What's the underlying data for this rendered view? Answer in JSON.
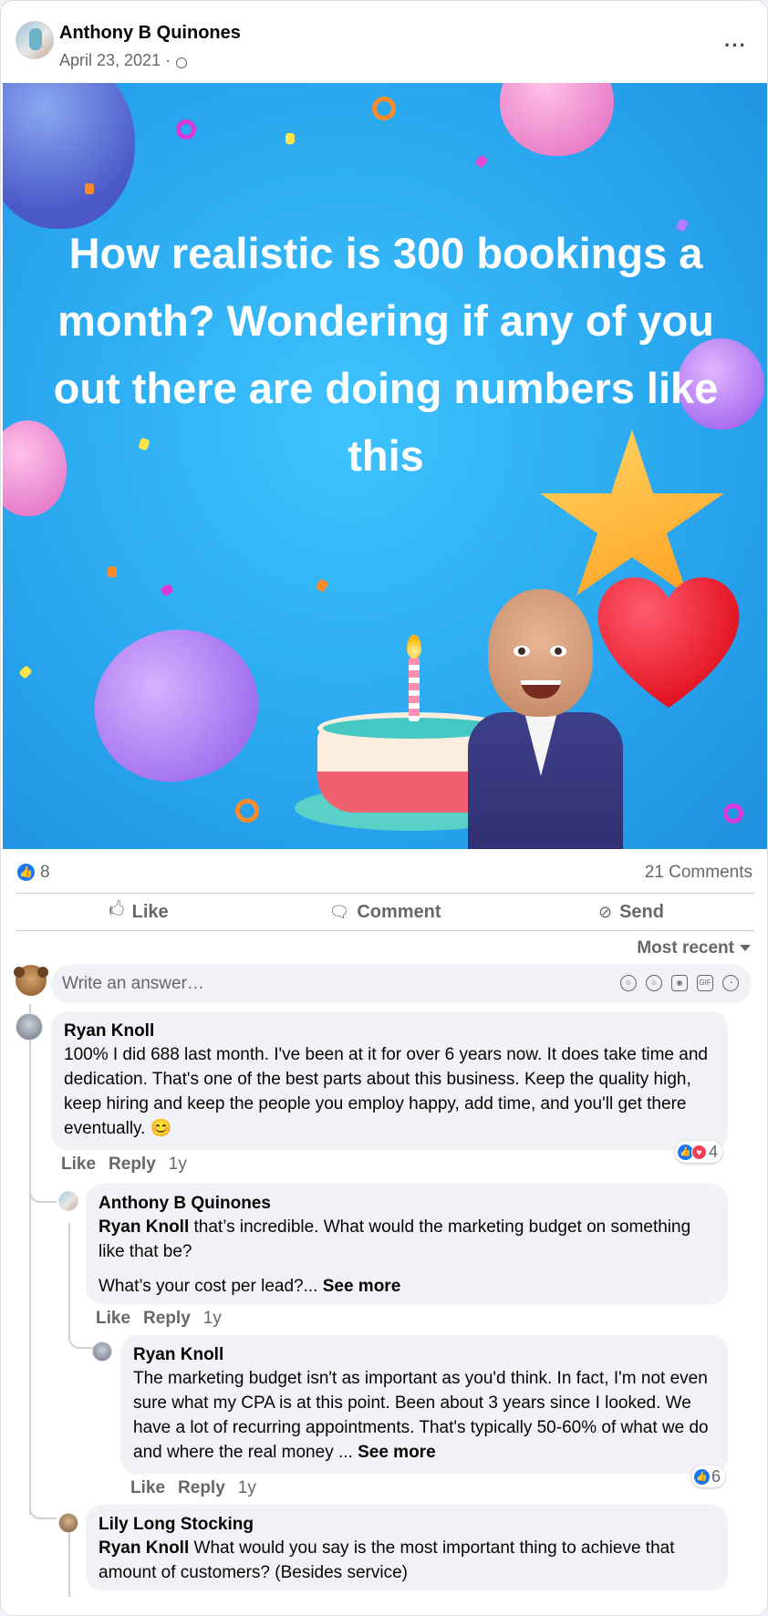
{
  "post": {
    "author": "Anthony B Quinones",
    "date": "April 23, 2021 ·",
    "more_label": "···",
    "banner_text": "How realistic is 300 bookings a month? Wondering if any of you out there are doing numbers like this"
  },
  "stats": {
    "like_count": "8",
    "comments_count": "21 Comments"
  },
  "actions": {
    "like": "Like",
    "comment": "Comment",
    "send": "Send"
  },
  "sort_label": "Most recent",
  "answer": {
    "placeholder": "Write an answer…",
    "icons": [
      "avatar-sticker-icon",
      "emoji-icon",
      "camera-icon",
      "gif-icon",
      "sticker-icon"
    ]
  },
  "comments": [
    {
      "name": "Ryan Knoll",
      "text": "100% I did 688 last month. I've been at it for over 6 years now. It does take time and dedication. That's one of the best parts about this business. Keep the quality high, keep hiring and keep the people you employ happy, add time, and you'll get there eventually. 😊",
      "like": "Like",
      "reply": "Reply",
      "time": "1y",
      "reactions": "4"
    },
    {
      "name": "Anthony B Quinones",
      "mention": "Ryan Knoll",
      "text": " that’s incredible. What would the marketing budget on something like that be?",
      "text2": "What’s your cost per lead?...",
      "see_more": "See more",
      "like": "Like",
      "reply": "Reply",
      "time": "1y"
    },
    {
      "name": "Ryan Knoll",
      "text": "The marketing budget isn't as important as you'd think. In fact, I'm not even sure what my CPA is at this point. Been about 3 years since I looked. We have a lot of recurring appointments. That's typically 50-60% of what we do and where the real money ...",
      "see_more": "See more",
      "like": "Like",
      "reply": "Reply",
      "time": "1y",
      "reactions": "6"
    },
    {
      "name": "Lily Long Stocking",
      "mention": "Ryan Knoll",
      "text": " What would you say is the most important thing to achieve that amount of customers? (Besides service)"
    }
  ],
  "colors": {
    "accent": "#1877f2",
    "love": "#f33e58",
    "bubble": "#f0f2f5",
    "muted": "#65676b"
  }
}
